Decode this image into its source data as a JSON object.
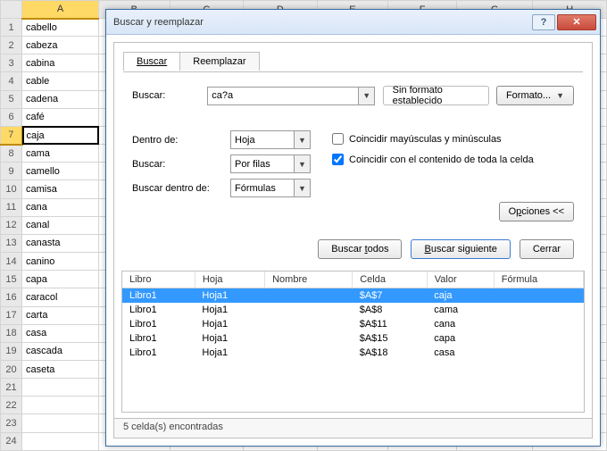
{
  "sheet": {
    "col_header": "A",
    "other_cols": [
      "B",
      "C",
      "D",
      "E",
      "F",
      "G",
      "H"
    ],
    "selected_row": 7,
    "rows": [
      "cabello",
      "cabeza",
      "cabina",
      "cable",
      "cadena",
      "café",
      "caja",
      "cama",
      "camello",
      "camisa",
      "cana",
      "canal",
      "canasta",
      "canino",
      "capa",
      "caracol",
      "carta",
      "casa",
      "cascada",
      "caseta",
      "",
      "",
      "",
      ""
    ]
  },
  "dialog": {
    "title": "Buscar y reemplazar",
    "tabs": {
      "find": "Buscar",
      "replace": "Reemplazar"
    },
    "find_label": "Buscar:",
    "find_value": "ca?a",
    "no_format": "Sin formato establecido",
    "format_btn": "Formato...",
    "within_label": "Dentro de:",
    "within_value": "Hoja",
    "search_label": "Buscar:",
    "search_value": "Por filas",
    "lookin_label": "Buscar dentro de:",
    "lookin_value": "Fórmulas",
    "match_case": "Coincidir mayúsculas y minúsculas",
    "match_entire": "Coincidir con el contenido de toda la celda",
    "options_btn": "Opciones <<",
    "find_all": "Buscar todos",
    "find_next": "Buscar siguiente",
    "close": "Cerrar",
    "cols": {
      "book": "Libro",
      "sheet": "Hoja",
      "name": "Nombre",
      "cell": "Celda",
      "value": "Valor",
      "formula": "Fórmula"
    },
    "results": [
      {
        "book": "Libro1",
        "sheet": "Hoja1",
        "name": "",
        "cell": "$A$7",
        "value": "caja",
        "sel": true
      },
      {
        "book": "Libro1",
        "sheet": "Hoja1",
        "name": "",
        "cell": "$A$8",
        "value": "cama",
        "sel": false
      },
      {
        "book": "Libro1",
        "sheet": "Hoja1",
        "name": "",
        "cell": "$A$11",
        "value": "cana",
        "sel": false
      },
      {
        "book": "Libro1",
        "sheet": "Hoja1",
        "name": "",
        "cell": "$A$15",
        "value": "capa",
        "sel": false
      },
      {
        "book": "Libro1",
        "sheet": "Hoja1",
        "name": "",
        "cell": "$A$18",
        "value": "casa",
        "sel": false
      }
    ],
    "status": "5 celda(s) encontradas"
  }
}
